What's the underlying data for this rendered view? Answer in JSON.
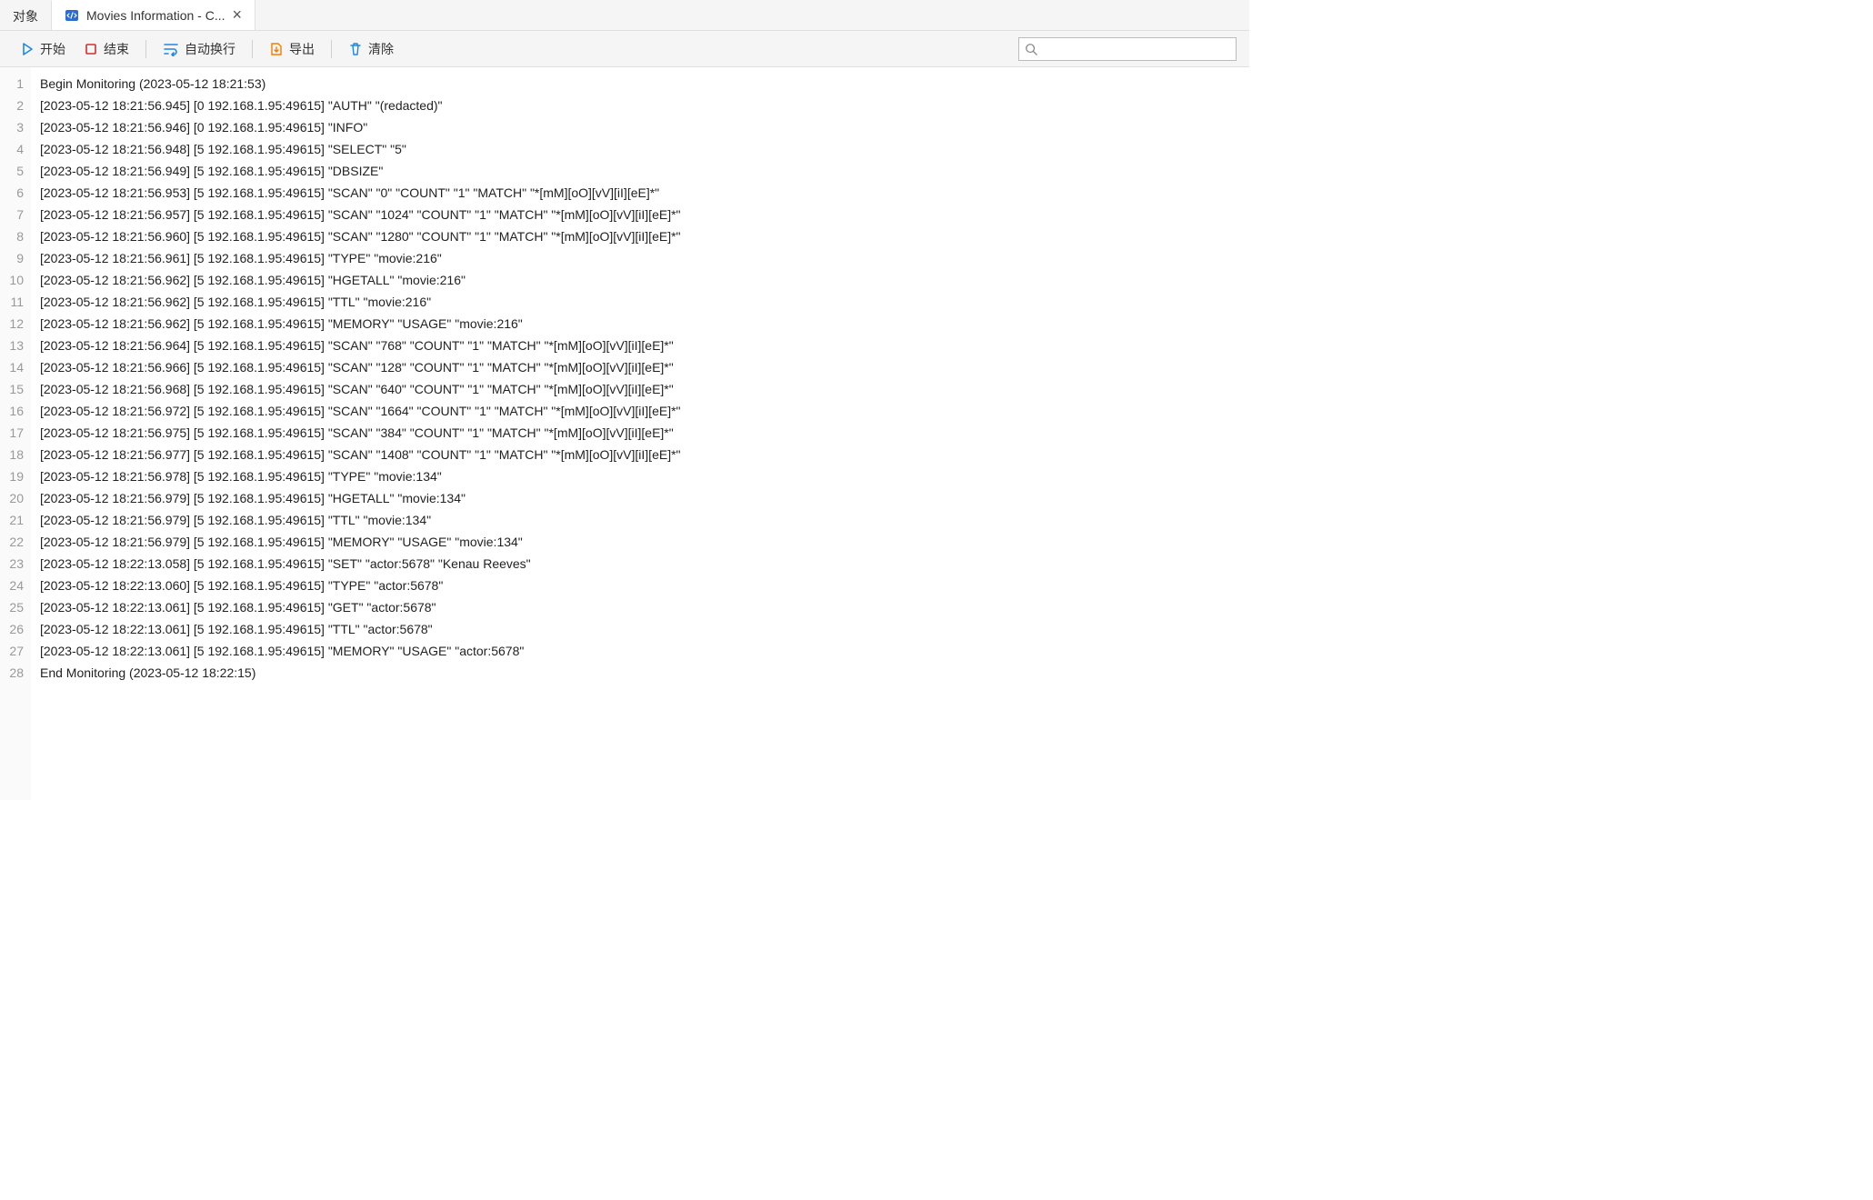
{
  "tabs": [
    {
      "label": "对象",
      "active": false
    },
    {
      "label": "Movies Information - C...",
      "active": true
    }
  ],
  "toolbar": {
    "start": "开始",
    "stop": "结束",
    "wrap": "自动换行",
    "export": "导出",
    "clear": "清除"
  },
  "search": {
    "placeholder": ""
  },
  "log": [
    "Begin Monitoring (2023-05-12 18:21:53)",
    "[2023-05-12 18:21:56.945] [0 192.168.1.95:49615] \"AUTH\" \"(redacted)\"",
    "[2023-05-12 18:21:56.946] [0 192.168.1.95:49615] \"INFO\"",
    "[2023-05-12 18:21:56.948] [5 192.168.1.95:49615] \"SELECT\" \"5\"",
    "[2023-05-12 18:21:56.949] [5 192.168.1.95:49615] \"DBSIZE\"",
    "[2023-05-12 18:21:56.953] [5 192.168.1.95:49615] \"SCAN\" \"0\" \"COUNT\" \"1\" \"MATCH\" \"*[mM][oO][vV][iI][eE]*\"",
    "[2023-05-12 18:21:56.957] [5 192.168.1.95:49615] \"SCAN\" \"1024\" \"COUNT\" \"1\" \"MATCH\" \"*[mM][oO][vV][iI][eE]*\"",
    "[2023-05-12 18:21:56.960] [5 192.168.1.95:49615] \"SCAN\" \"1280\" \"COUNT\" \"1\" \"MATCH\" \"*[mM][oO][vV][iI][eE]*\"",
    "[2023-05-12 18:21:56.961] [5 192.168.1.95:49615] \"TYPE\" \"movie:216\"",
    "[2023-05-12 18:21:56.962] [5 192.168.1.95:49615] \"HGETALL\" \"movie:216\"",
    "[2023-05-12 18:21:56.962] [5 192.168.1.95:49615] \"TTL\" \"movie:216\"",
    "[2023-05-12 18:21:56.962] [5 192.168.1.95:49615] \"MEMORY\" \"USAGE\" \"movie:216\"",
    "[2023-05-12 18:21:56.964] [5 192.168.1.95:49615] \"SCAN\" \"768\" \"COUNT\" \"1\" \"MATCH\" \"*[mM][oO][vV][iI][eE]*\"",
    "[2023-05-12 18:21:56.966] [5 192.168.1.95:49615] \"SCAN\" \"128\" \"COUNT\" \"1\" \"MATCH\" \"*[mM][oO][vV][iI][eE]*\"",
    "[2023-05-12 18:21:56.968] [5 192.168.1.95:49615] \"SCAN\" \"640\" \"COUNT\" \"1\" \"MATCH\" \"*[mM][oO][vV][iI][eE]*\"",
    "[2023-05-12 18:21:56.972] [5 192.168.1.95:49615] \"SCAN\" \"1664\" \"COUNT\" \"1\" \"MATCH\" \"*[mM][oO][vV][iI][eE]*\"",
    "[2023-05-12 18:21:56.975] [5 192.168.1.95:49615] \"SCAN\" \"384\" \"COUNT\" \"1\" \"MATCH\" \"*[mM][oO][vV][iI][eE]*\"",
    "[2023-05-12 18:21:56.977] [5 192.168.1.95:49615] \"SCAN\" \"1408\" \"COUNT\" \"1\" \"MATCH\" \"*[mM][oO][vV][iI][eE]*\"",
    "[2023-05-12 18:21:56.978] [5 192.168.1.95:49615] \"TYPE\" \"movie:134\"",
    "[2023-05-12 18:21:56.979] [5 192.168.1.95:49615] \"HGETALL\" \"movie:134\"",
    "[2023-05-12 18:21:56.979] [5 192.168.1.95:49615] \"TTL\" \"movie:134\"",
    "[2023-05-12 18:21:56.979] [5 192.168.1.95:49615] \"MEMORY\" \"USAGE\" \"movie:134\"",
    "[2023-05-12 18:22:13.058] [5 192.168.1.95:49615] \"SET\" \"actor:5678\" \"Kenau Reeves\"",
    "[2023-05-12 18:22:13.060] [5 192.168.1.95:49615] \"TYPE\" \"actor:5678\"",
    "[2023-05-12 18:22:13.061] [5 192.168.1.95:49615] \"GET\" \"actor:5678\"",
    "[2023-05-12 18:22:13.061] [5 192.168.1.95:49615] \"TTL\" \"actor:5678\"",
    "[2023-05-12 18:22:13.061] [5 192.168.1.95:49615] \"MEMORY\" \"USAGE\" \"actor:5678\"",
    "End Monitoring (2023-05-12 18:22:15)"
  ]
}
